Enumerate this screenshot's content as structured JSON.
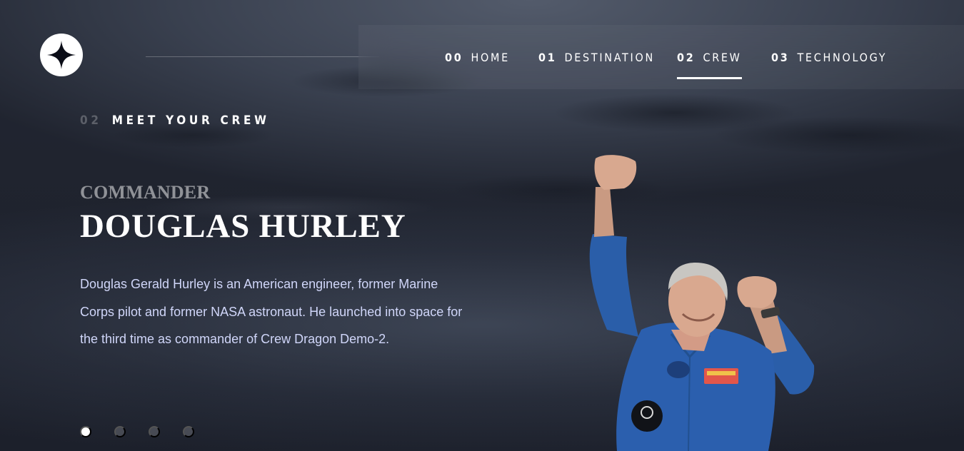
{
  "nav": {
    "items": [
      {
        "num": "00",
        "label": "HOME",
        "active": false
      },
      {
        "num": "01",
        "label": "DESTINATION",
        "active": false
      },
      {
        "num": "02",
        "label": "CREW",
        "active": true
      },
      {
        "num": "03",
        "label": "TECHNOLOGY",
        "active": false
      }
    ]
  },
  "section": {
    "num": "02",
    "title": "MEET YOUR CREW"
  },
  "crew": {
    "role": "Commander",
    "name": "Douglas Hurley",
    "bio": "Douglas Gerald Hurley is an American engineer, former Marine Corps pilot and former NASA astronaut. He launched into space for the third time as commander of Crew Dragon Demo-2."
  },
  "slider": {
    "count": 4,
    "active_index": 0
  },
  "icons": {
    "logo": "star-logo-icon"
  },
  "colors": {
    "background": "#0b0d17",
    "text": "#ffffff",
    "body": "#d0d6f9",
    "suit": "#2b5fae"
  }
}
